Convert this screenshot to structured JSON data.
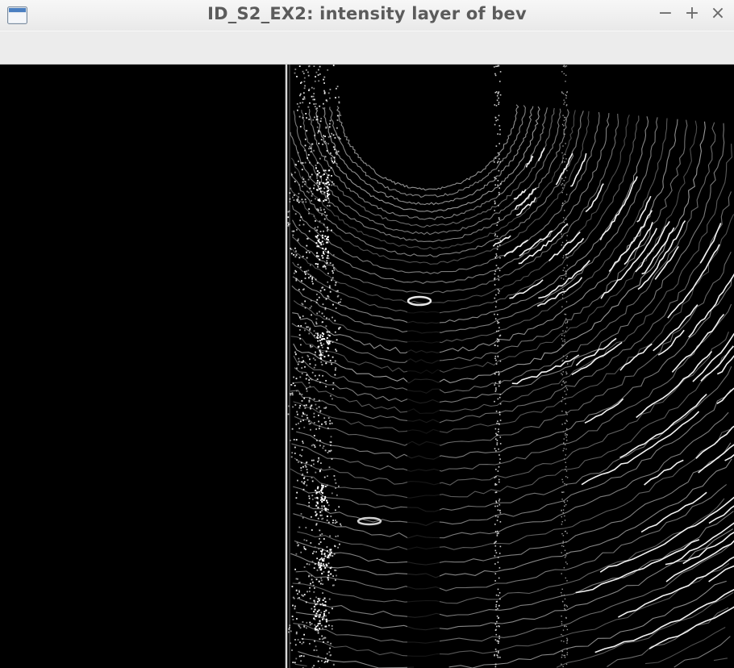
{
  "window": {
    "title": "ID_S2_EX2: intensity layer of bev",
    "icon": "window-app-icon",
    "controls": {
      "minimize": "−",
      "maximize": "+",
      "close": "×"
    }
  },
  "image": {
    "description_icon": "lidar-bev-intensity-image",
    "background": "#000000",
    "foreground": "#ffffff"
  }
}
